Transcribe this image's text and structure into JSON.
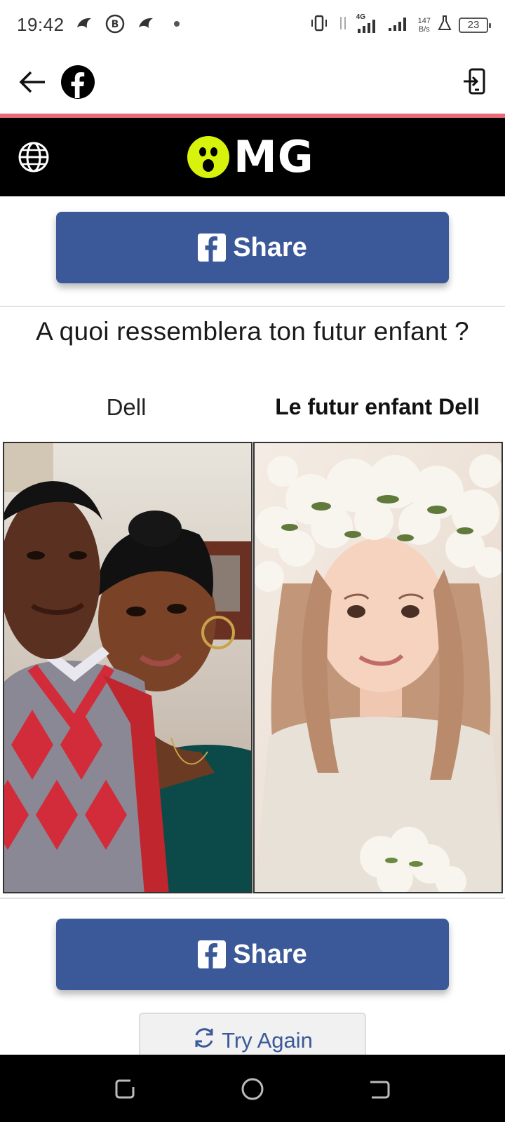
{
  "status_bar": {
    "time": "19:42",
    "network_label": "4G",
    "speed_value": "147",
    "speed_unit": "B/s",
    "battery": "23"
  },
  "app_bar": {
    "back_icon": "arrow-left-icon",
    "brand_icon": "facebook-logo-icon",
    "exit_icon": "exit-app-icon"
  },
  "site_header": {
    "logo_text": "MG",
    "logo_color": "#d7f20c",
    "globe_icon": "globe-icon"
  },
  "share_top": {
    "label": "Share"
  },
  "question": "A quoi ressemblera ton futur enfant ?",
  "result": {
    "left_caption": "Dell",
    "right_caption": "Le futur enfant Dell"
  },
  "share_bottom": {
    "label": "Share"
  },
  "try_again": {
    "label": "Try Again",
    "icon": "refresh-icon"
  },
  "colors": {
    "facebook_blue": "#3b5998",
    "accent_line": "#e96b78"
  },
  "nav_bar": {
    "recents_icon": "recents-icon",
    "home_icon": "home-circle-icon",
    "back_icon": "back-nav-icon"
  }
}
